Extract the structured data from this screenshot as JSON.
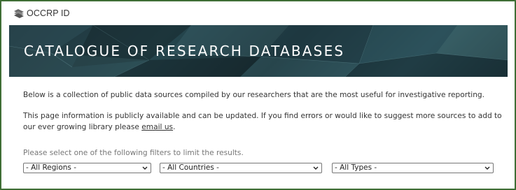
{
  "header": {
    "logo_text": "OCCRP ID"
  },
  "banner": {
    "title": "CATALOGUE OF RESEARCH DATABASES"
  },
  "intro": {
    "paragraph1": "Below is a collection of public data sources compiled by our researchers that are the most useful for investigative reporting.",
    "paragraph2_before_link": "This page information is publicly available and can be updated. If you find errors or would like to suggest more sources to add to our ever growing library please ",
    "paragraph2_link": "email us",
    "paragraph2_after_link": "."
  },
  "filters": {
    "label": "Please select one of the following filters to limit the results.",
    "region_selected": "- All Regions -",
    "country_selected": "- All Countries -",
    "type_selected": "- All Types -"
  },
  "colors": {
    "frame_border": "#3f6e35",
    "banner_dark": "#1d3138",
    "text": "#333333"
  },
  "icons": {
    "logo": "occrp-logo-icon",
    "dropdown": "chevron-down-icon"
  }
}
